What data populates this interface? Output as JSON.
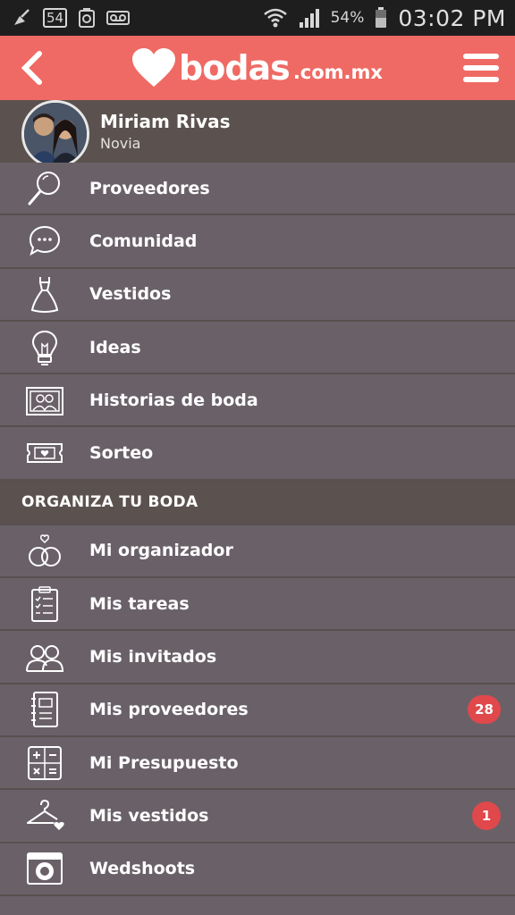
{
  "status": {
    "notif_num": "54",
    "battery_pct": "54%",
    "time": "03:02 PM"
  },
  "app": {
    "logo_word": "bodas",
    "logo_domain": ".com.mx"
  },
  "profile": {
    "name": "Miriam Rivas",
    "role": "Novia"
  },
  "menu": {
    "items": [
      {
        "label": "Proveedores",
        "icon": "search-icon"
      },
      {
        "label": "Comunidad",
        "icon": "chat-icon"
      },
      {
        "label": "Vestidos",
        "icon": "dress-icon"
      },
      {
        "label": "Ideas",
        "icon": "lightbulb-icon"
      },
      {
        "label": "Historias de boda",
        "icon": "photos-icon"
      },
      {
        "label": "Sorteo",
        "icon": "ticket-icon"
      }
    ],
    "section_title": "ORGANIZA TU BODA",
    "organize": [
      {
        "label": "Mi organizador",
        "icon": "rings-icon"
      },
      {
        "label": "Mis tareas",
        "icon": "checklist-icon"
      },
      {
        "label": "Mis invitados",
        "icon": "guests-icon"
      },
      {
        "label": "Mis proveedores",
        "icon": "notebook-icon",
        "badge": "28"
      },
      {
        "label": "Mi Presupuesto",
        "icon": "calculator-icon"
      },
      {
        "label": "Mis vestidos",
        "icon": "hanger-icon",
        "badge": "1"
      },
      {
        "label": "Wedshoots",
        "icon": "camera-icon"
      }
    ]
  }
}
